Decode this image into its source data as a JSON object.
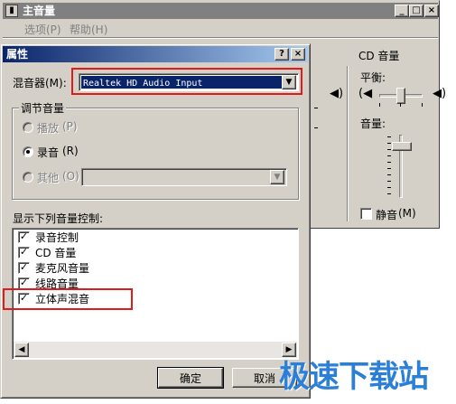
{
  "mixer": {
    "title": "主音量",
    "menu": [
      "选项(P)",
      "帮助(H)"
    ],
    "column_title": "CD 音量",
    "balance_label": "平衡:",
    "volume_label": "音量:",
    "mute_label": "静音",
    "mute_hotkey": "(M)",
    "mute_checked": false,
    "volume_level": 0.85,
    "balance_level": 0.5,
    "caption_buttons": [
      "_",
      "□",
      "×"
    ]
  },
  "dialog": {
    "title": "属性",
    "help_button": "?",
    "close_button": "×",
    "mixer_label": "混音器(M):",
    "mixer_value": "Realtek HD Audio Input",
    "adjust_group": "调节音量",
    "radios": [
      {
        "label": "播放",
        "hotkey": "(P)",
        "checked": false,
        "enabled": false
      },
      {
        "label": "录音",
        "hotkey": "(R)",
        "checked": true,
        "enabled": true
      },
      {
        "label": "其他",
        "hotkey": "(O)",
        "checked": false,
        "enabled": false
      }
    ],
    "show_label": "显示下列音量控制:",
    "controls": [
      {
        "label": "录音控制",
        "checked": true
      },
      {
        "label": "CD 音量",
        "checked": true
      },
      {
        "label": "麦克风音量",
        "checked": true
      },
      {
        "label": "线路音量",
        "checked": true
      },
      {
        "label": "立体声混音",
        "checked": true
      }
    ],
    "ok_button": "确定",
    "cancel_button": "取消"
  },
  "watermark": "极速下载站",
  "colors": {
    "highlight_box": "#e01b1b",
    "selection": "#0a246a",
    "face": "#d4d0c8"
  }
}
